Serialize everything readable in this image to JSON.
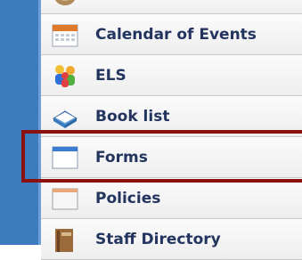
{
  "menu": {
    "items": [
      {
        "label": "",
        "icon": "misc-icon"
      },
      {
        "label": "Calendar of Events",
        "icon": "calendar-icon"
      },
      {
        "label": "ELS",
        "icon": "people-icon"
      },
      {
        "label": "Book list",
        "icon": "book-icon"
      },
      {
        "label": "Forms",
        "icon": "form-icon"
      },
      {
        "label": "Policies",
        "icon": "document-icon"
      },
      {
        "label": "Staff Directory",
        "icon": "directory-icon"
      }
    ]
  },
  "colors": {
    "sidebar_blue": "#3d7bbf",
    "label_text": "#23345e",
    "highlight_border": "#8b1010"
  }
}
